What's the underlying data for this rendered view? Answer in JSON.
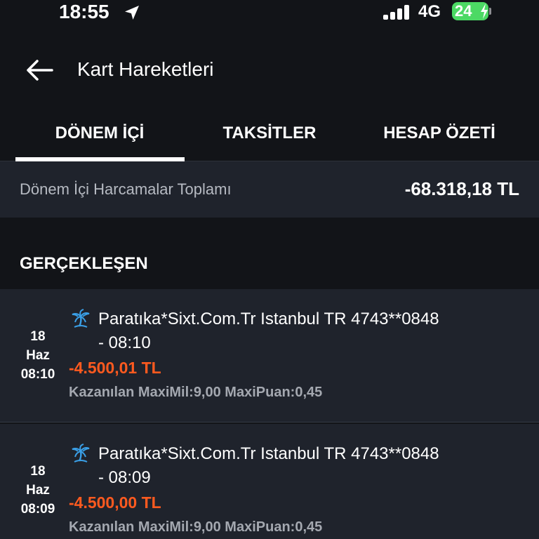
{
  "status_bar": {
    "time": "18:55",
    "network": "4G",
    "battery_level": "24"
  },
  "header": {
    "title": "Kart Hareketleri",
    "back_icon": "arrow-left-icon"
  },
  "tabs": [
    {
      "label": "DÖNEM İÇİ",
      "selected": true
    },
    {
      "label": "TAKSİTLER",
      "selected": false
    },
    {
      "label": "HESAP ÖZETİ",
      "selected": false
    }
  ],
  "summary": {
    "label": "Dönem İçi Harcamalar Toplamı",
    "total": "-68.318,18 TL"
  },
  "section": {
    "title": "GERÇEKLEŞEN"
  },
  "transactions": [
    {
      "day": "18",
      "month": "Haz",
      "time": "08:10",
      "icon": "palm-tree-icon",
      "merchant_line1": "Paratıka*Sixt.Com.Tr Istanbul TR 4743**0848",
      "merchant_line2": "- 08:10",
      "amount": "-4.500,01 TL",
      "rewards": "Kazanılan MaxiMil:9,00 MaxiPuan:0,45"
    },
    {
      "day": "18",
      "month": "Haz",
      "time": "08:09",
      "icon": "palm-tree-icon",
      "merchant_line1": "Paratıka*Sixt.Com.Tr Istanbul TR 4743**0848",
      "merchant_line2": "- 08:09",
      "amount": "-4.500,00 TL",
      "rewards": "Kazanılan MaxiMil:9,00 MaxiPuan:0,45"
    }
  ],
  "colors": {
    "background": "#121418",
    "card": "#1f232c",
    "amount": "#ff5a1f",
    "rewards": "#a4a8b0",
    "battery": "#4cd964"
  }
}
